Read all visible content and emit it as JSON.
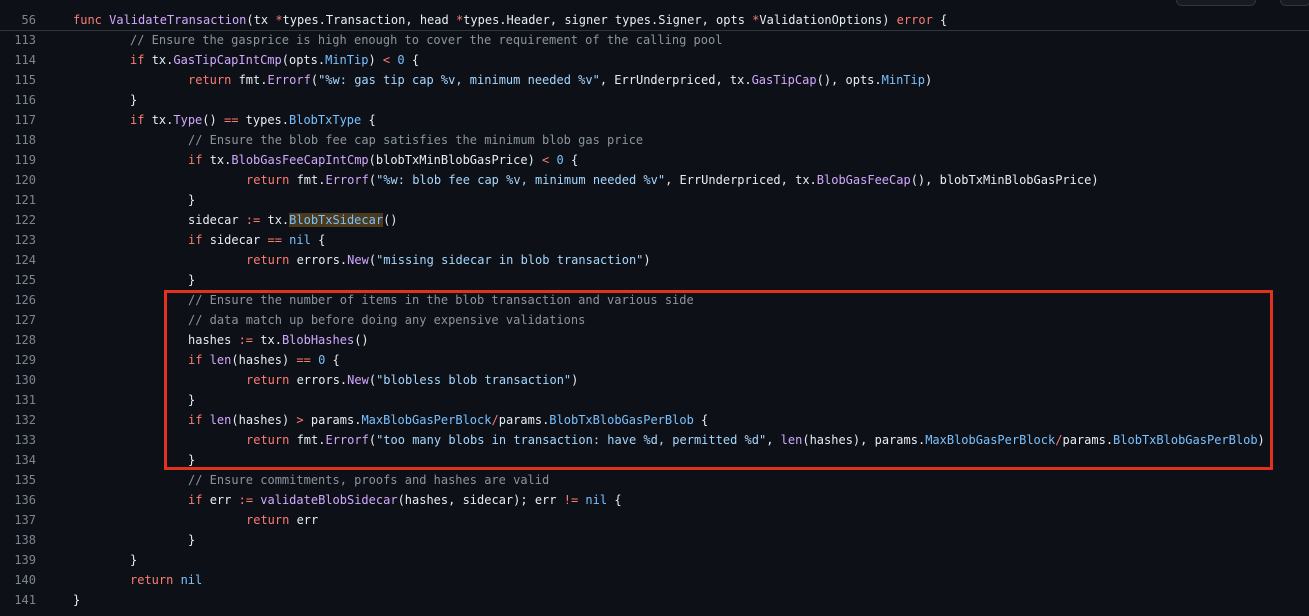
{
  "header": {
    "line_number": "56",
    "tokens": [
      {
        "t": "func ",
        "k": "kw"
      },
      {
        "t": "ValidateTransaction",
        "k": "fn"
      },
      {
        "t": "(tx ",
        "k": "id"
      },
      {
        "t": "*",
        "k": "op"
      },
      {
        "t": "types.Transaction, head ",
        "k": "id"
      },
      {
        "t": "*",
        "k": "op"
      },
      {
        "t": "types.Header, signer types.Signer, opts ",
        "k": "id"
      },
      {
        "t": "*",
        "k": "op"
      },
      {
        "t": "ValidationOptions) ",
        "k": "id"
      },
      {
        "t": "error",
        "k": "kw"
      },
      {
        "t": " {",
        "k": "id"
      }
    ]
  },
  "lines": [
    {
      "n": "113",
      "indent": 2,
      "tokens": [
        {
          "t": "// Ensure the gasprice is high enough to cover the requirement of the calling pool",
          "k": "com"
        }
      ]
    },
    {
      "n": "114",
      "indent": 2,
      "tokens": [
        {
          "t": "if ",
          "k": "kw"
        },
        {
          "t": "tx.",
          "k": "id"
        },
        {
          "t": "GasTipCapIntCmp",
          "k": "fn"
        },
        {
          "t": "(opts.",
          "k": "id"
        },
        {
          "t": "MinTip",
          "k": "mem"
        },
        {
          "t": ") ",
          "k": "id"
        },
        {
          "t": "<",
          "k": "op"
        },
        {
          "t": " ",
          "k": "id"
        },
        {
          "t": "0",
          "k": "num"
        },
        {
          "t": " {",
          "k": "id"
        }
      ]
    },
    {
      "n": "115",
      "indent": 3,
      "tokens": [
        {
          "t": "return ",
          "k": "kw"
        },
        {
          "t": "fmt.",
          "k": "id"
        },
        {
          "t": "Errorf",
          "k": "fn"
        },
        {
          "t": "(",
          "k": "id"
        },
        {
          "t": "\"%w: gas tip cap %v, minimum needed %v\"",
          "k": "str"
        },
        {
          "t": ", ErrUnderpriced, tx.",
          "k": "id"
        },
        {
          "t": "GasTipCap",
          "k": "fn"
        },
        {
          "t": "(), opts.",
          "k": "id"
        },
        {
          "t": "MinTip",
          "k": "mem"
        },
        {
          "t": ")",
          "k": "id"
        }
      ]
    },
    {
      "n": "116",
      "indent": 2,
      "tokens": [
        {
          "t": "}",
          "k": "id"
        }
      ]
    },
    {
      "n": "117",
      "indent": 2,
      "tokens": [
        {
          "t": "if ",
          "k": "kw"
        },
        {
          "t": "tx.",
          "k": "id"
        },
        {
          "t": "Type",
          "k": "fn"
        },
        {
          "t": "() ",
          "k": "id"
        },
        {
          "t": "==",
          "k": "op"
        },
        {
          "t": " types.",
          "k": "id"
        },
        {
          "t": "BlobTxType",
          "k": "mem"
        },
        {
          "t": " {",
          "k": "id"
        }
      ]
    },
    {
      "n": "118",
      "indent": 3,
      "tokens": [
        {
          "t": "// Ensure the blob fee cap satisfies the minimum blob gas price",
          "k": "com"
        }
      ]
    },
    {
      "n": "119",
      "indent": 3,
      "tokens": [
        {
          "t": "if ",
          "k": "kw"
        },
        {
          "t": "tx.",
          "k": "id"
        },
        {
          "t": "BlobGasFeeCapIntCmp",
          "k": "fn"
        },
        {
          "t": "(blobTxMinBlobGasPrice) ",
          "k": "id"
        },
        {
          "t": "<",
          "k": "op"
        },
        {
          "t": " ",
          "k": "id"
        },
        {
          "t": "0",
          "k": "num"
        },
        {
          "t": " {",
          "k": "id"
        }
      ]
    },
    {
      "n": "120",
      "indent": 4,
      "tokens": [
        {
          "t": "return ",
          "k": "kw"
        },
        {
          "t": "fmt.",
          "k": "id"
        },
        {
          "t": "Errorf",
          "k": "fn"
        },
        {
          "t": "(",
          "k": "id"
        },
        {
          "t": "\"%w: blob fee cap %v, minimum needed %v\"",
          "k": "str"
        },
        {
          "t": ", ErrUnderpriced, tx.",
          "k": "id"
        },
        {
          "t": "BlobGasFeeCap",
          "k": "fn"
        },
        {
          "t": "(), blobTxMinBlobGasPrice)",
          "k": "id"
        }
      ]
    },
    {
      "n": "121",
      "indent": 3,
      "tokens": [
        {
          "t": "}",
          "k": "id"
        }
      ]
    },
    {
      "n": "122",
      "indent": 3,
      "tokens": [
        {
          "t": "sidecar ",
          "k": "id"
        },
        {
          "t": ":=",
          "k": "op"
        },
        {
          "t": " tx.",
          "k": "id"
        },
        {
          "t": "BlobTxSidecar",
          "k": "hl"
        },
        {
          "t": "()",
          "k": "id"
        }
      ]
    },
    {
      "n": "123",
      "indent": 3,
      "tokens": [
        {
          "t": "if ",
          "k": "kw"
        },
        {
          "t": "sidecar ",
          "k": "id"
        },
        {
          "t": "==",
          "k": "op"
        },
        {
          "t": " ",
          "k": "id"
        },
        {
          "t": "nil",
          "k": "num"
        },
        {
          "t": " {",
          "k": "id"
        }
      ]
    },
    {
      "n": "124",
      "indent": 4,
      "tokens": [
        {
          "t": "return ",
          "k": "kw"
        },
        {
          "t": "errors.",
          "k": "id"
        },
        {
          "t": "New",
          "k": "fn"
        },
        {
          "t": "(",
          "k": "id"
        },
        {
          "t": "\"missing sidecar in blob transaction\"",
          "k": "str"
        },
        {
          "t": ")",
          "k": "id"
        }
      ]
    },
    {
      "n": "125",
      "indent": 3,
      "tokens": [
        {
          "t": "}",
          "k": "id"
        }
      ]
    },
    {
      "n": "126",
      "indent": 3,
      "tokens": [
        {
          "t": "// Ensure the number of items in the blob transaction and various side",
          "k": "com"
        }
      ]
    },
    {
      "n": "127",
      "indent": 3,
      "tokens": [
        {
          "t": "// data match up before doing any expensive validations",
          "k": "com"
        }
      ]
    },
    {
      "n": "128",
      "indent": 3,
      "tokens": [
        {
          "t": "hashes ",
          "k": "id"
        },
        {
          "t": ":=",
          "k": "op"
        },
        {
          "t": " tx.",
          "k": "id"
        },
        {
          "t": "BlobHashes",
          "k": "fn"
        },
        {
          "t": "()",
          "k": "id"
        }
      ]
    },
    {
      "n": "129",
      "indent": 3,
      "tokens": [
        {
          "t": "if ",
          "k": "kw"
        },
        {
          "t": "len",
          "k": "fn"
        },
        {
          "t": "(hashes) ",
          "k": "id"
        },
        {
          "t": "==",
          "k": "op"
        },
        {
          "t": " ",
          "k": "id"
        },
        {
          "t": "0",
          "k": "num"
        },
        {
          "t": " {",
          "k": "id"
        }
      ]
    },
    {
      "n": "130",
      "indent": 4,
      "tokens": [
        {
          "t": "return ",
          "k": "kw"
        },
        {
          "t": "errors.",
          "k": "id"
        },
        {
          "t": "New",
          "k": "fn"
        },
        {
          "t": "(",
          "k": "id"
        },
        {
          "t": "\"blobless blob transaction\"",
          "k": "str"
        },
        {
          "t": ")",
          "k": "id"
        }
      ]
    },
    {
      "n": "131",
      "indent": 3,
      "tokens": [
        {
          "t": "}",
          "k": "id"
        }
      ]
    },
    {
      "n": "132",
      "indent": 3,
      "tokens": [
        {
          "t": "if ",
          "k": "kw"
        },
        {
          "t": "len",
          "k": "fn"
        },
        {
          "t": "(hashes) ",
          "k": "id"
        },
        {
          "t": ">",
          "k": "op"
        },
        {
          "t": " params.",
          "k": "id"
        },
        {
          "t": "MaxBlobGasPerBlock",
          "k": "mem"
        },
        {
          "t": "/",
          "k": "op"
        },
        {
          "t": "params.",
          "k": "id"
        },
        {
          "t": "BlobTxBlobGasPerBlob",
          "k": "mem"
        },
        {
          "t": " {",
          "k": "id"
        }
      ]
    },
    {
      "n": "133",
      "indent": 4,
      "tokens": [
        {
          "t": "return ",
          "k": "kw"
        },
        {
          "t": "fmt.",
          "k": "id"
        },
        {
          "t": "Errorf",
          "k": "fn"
        },
        {
          "t": "(",
          "k": "id"
        },
        {
          "t": "\"too many blobs in transaction: have %d, permitted %d\"",
          "k": "str"
        },
        {
          "t": ", ",
          "k": "id"
        },
        {
          "t": "len",
          "k": "fn"
        },
        {
          "t": "(hashes), params.",
          "k": "id"
        },
        {
          "t": "MaxBlobGasPerBlock",
          "k": "mem"
        },
        {
          "t": "/",
          "k": "op"
        },
        {
          "t": "params.",
          "k": "id"
        },
        {
          "t": "BlobTxBlobGasPerBlob",
          "k": "mem"
        },
        {
          "t": ")",
          "k": "id"
        }
      ]
    },
    {
      "n": "134",
      "indent": 3,
      "tokens": [
        {
          "t": "}",
          "k": "id"
        }
      ]
    },
    {
      "n": "135",
      "indent": 3,
      "tokens": [
        {
          "t": "// Ensure commitments, proofs and hashes are valid",
          "k": "com"
        }
      ]
    },
    {
      "n": "136",
      "indent": 3,
      "tokens": [
        {
          "t": "if ",
          "k": "kw"
        },
        {
          "t": "err ",
          "k": "id"
        },
        {
          "t": ":=",
          "k": "op"
        },
        {
          "t": " ",
          "k": "id"
        },
        {
          "t": "validateBlobSidecar",
          "k": "fn"
        },
        {
          "t": "(hashes, sidecar); err ",
          "k": "id"
        },
        {
          "t": "!=",
          "k": "op"
        },
        {
          "t": " ",
          "k": "id"
        },
        {
          "t": "nil",
          "k": "num"
        },
        {
          "t": " {",
          "k": "id"
        }
      ]
    },
    {
      "n": "137",
      "indent": 4,
      "tokens": [
        {
          "t": "return ",
          "k": "kw"
        },
        {
          "t": "err",
          "k": "id"
        }
      ]
    },
    {
      "n": "138",
      "indent": 3,
      "tokens": [
        {
          "t": "}",
          "k": "id"
        }
      ]
    },
    {
      "n": "139",
      "indent": 2,
      "tokens": [
        {
          "t": "}",
          "k": "id"
        }
      ]
    },
    {
      "n": "140",
      "indent": 2,
      "tokens": [
        {
          "t": "return ",
          "k": "kw"
        },
        {
          "t": "nil",
          "k": "num"
        }
      ]
    },
    {
      "n": "141",
      "indent": 1,
      "tokens": [
        {
          "t": "}",
          "k": "id"
        }
      ]
    }
  ],
  "colors": {
    "background": "#0d1117",
    "line_number": "#7d8590",
    "keyword": "#ff7b72",
    "function": "#d2a8ff",
    "string": "#a5d6ff",
    "comment": "#8b949e",
    "constant": "#79c0ff",
    "annotation_box": "#e0321e"
  }
}
